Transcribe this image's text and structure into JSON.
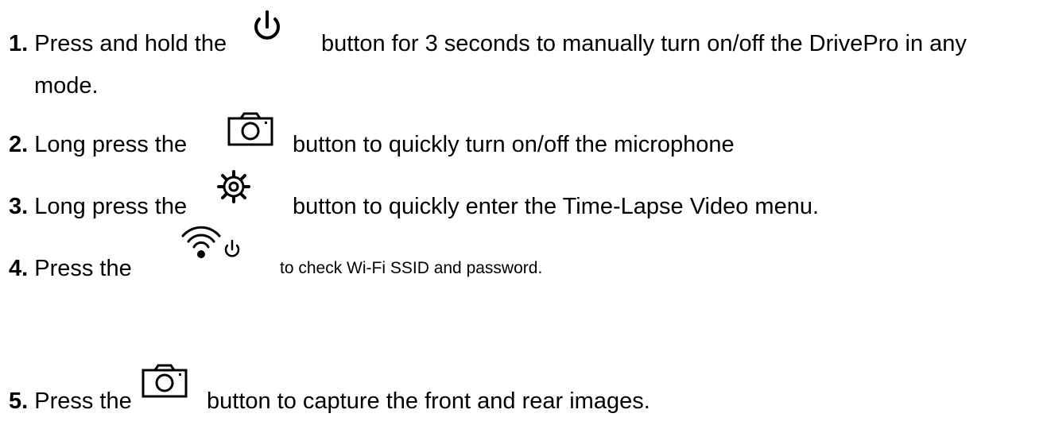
{
  "steps": [
    {
      "number": "1.",
      "before": "Press and hold the",
      "icon": "power-icon",
      "after": "button for 3 seconds to manually turn on/off the DrivePro in any",
      "continuation": "mode."
    },
    {
      "number": "2.",
      "before": "Long press the",
      "icon": "camera-icon",
      "after": "button to quickly turn on/off the microphone"
    },
    {
      "number": "3.",
      "before": "Long press the",
      "icon": "settings-gear-icon",
      "after": "button to quickly enter the Time-Lapse Video menu."
    },
    {
      "number": "4.",
      "before": "Press the",
      "icon": "wifi-power-icon",
      "after": "to check Wi-Fi SSID and password."
    },
    {
      "number": "5.",
      "before": "Press the",
      "icon": "camera-icon",
      "after": "button to capture the front and rear images."
    }
  ]
}
